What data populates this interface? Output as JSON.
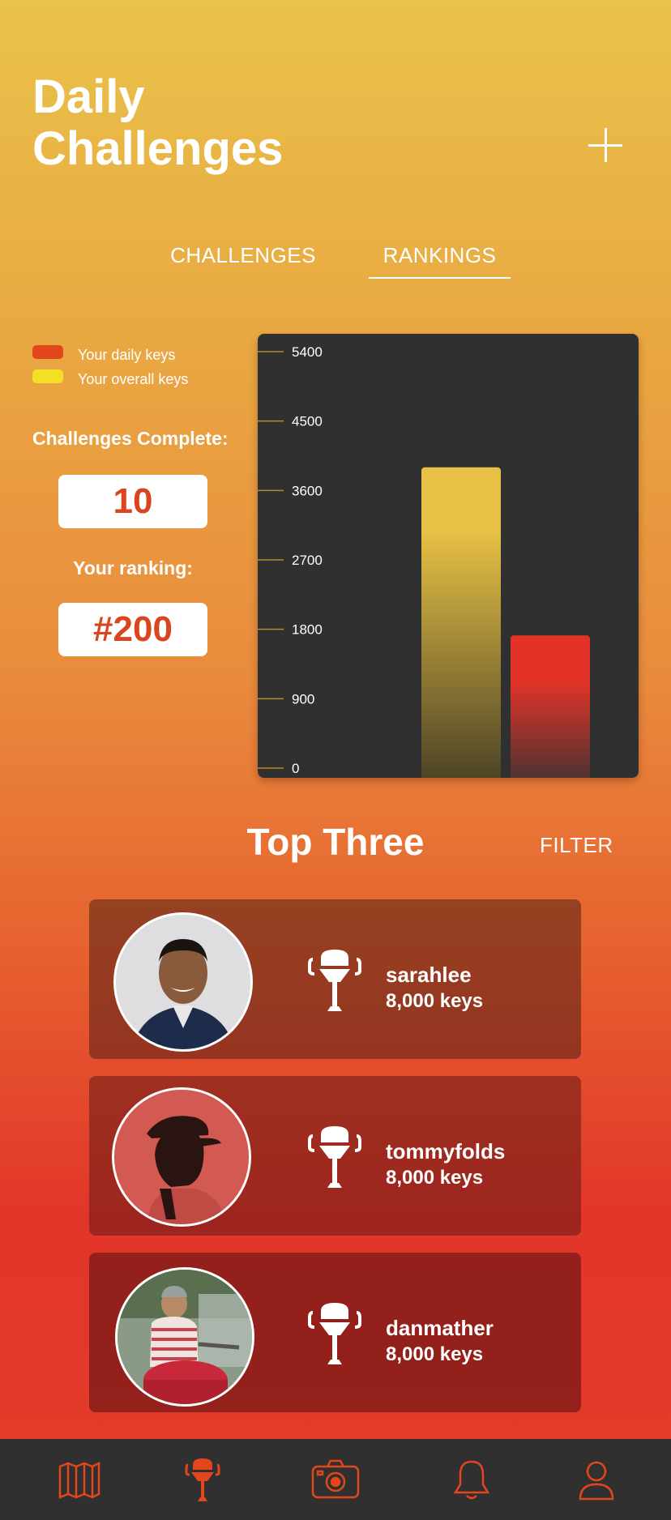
{
  "header": {
    "title_line1": "Daily",
    "title_line2": "Challenges",
    "add_icon": "plus-icon"
  },
  "tabs": [
    {
      "label": "CHALLENGES",
      "active": false
    },
    {
      "label": "RANKINGS",
      "active": true
    }
  ],
  "legend": [
    {
      "label": "Your daily keys",
      "color": "#e2471c"
    },
    {
      "label": "Your overall keys",
      "color": "#f3df23"
    }
  ],
  "stats": {
    "challenges_label": "Challenges Complete:",
    "challenges_value": "10",
    "ranking_label": "Your ranking:",
    "ranking_value": "#200"
  },
  "chart_data": {
    "type": "bar",
    "yticks": [
      0,
      900,
      1800,
      2700,
      3600,
      4500,
      5400
    ],
    "ylim": [
      0,
      5400
    ],
    "series": [
      {
        "key": "overall",
        "value": 3900,
        "color_top": "#e7c145",
        "color_bottom": "#4a4226"
      },
      {
        "key": "daily",
        "value": 1720,
        "color_top": "#e33328",
        "color_bottom": "#4a3332"
      }
    ],
    "legend_placement": "left"
  },
  "top_three": {
    "title": "Top Three",
    "filter_label": "FILTER",
    "entries": [
      {
        "username": "sarahlee",
        "keys": "8,000 keys",
        "trophy_icon": "trophy-icon",
        "avatar_icon": "avatar-photo-icon"
      },
      {
        "username": "tommyfolds",
        "keys": "8,000 keys",
        "trophy_icon": "trophy-icon",
        "avatar_icon": "avatar-photo-icon"
      },
      {
        "username": "danmather",
        "keys": "8,000 keys",
        "trophy_icon": "trophy-icon",
        "avatar_icon": "avatar-photo-icon"
      }
    ]
  },
  "nav": {
    "items": [
      {
        "icon": "map-icon",
        "active": false
      },
      {
        "icon": "grill-icon",
        "active": true
      },
      {
        "icon": "camera-icon",
        "active": false
      },
      {
        "icon": "bell-icon",
        "active": false
      },
      {
        "icon": "profile-icon",
        "active": false
      }
    ],
    "icon_color": "#e2471c"
  }
}
